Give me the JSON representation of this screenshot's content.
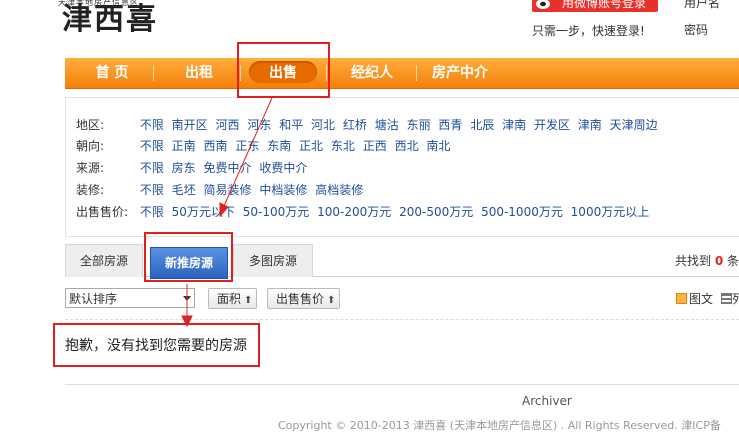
{
  "header": {
    "logo_slogan": "天津本地房产信息区",
    "logo_text": "津西喜",
    "weibo_login": "用微博账号登录",
    "quick_login": "只需一步，快速登录!",
    "username_label": "用户名",
    "password_label": "密码"
  },
  "nav": {
    "items": [
      "首 页",
      "出租",
      "出售",
      "经纪人",
      "房产中介"
    ],
    "active": "出售"
  },
  "filters": [
    {
      "label": "地区:",
      "options": [
        "不限",
        "南开区",
        "河西",
        "河东",
        "和平",
        "河北",
        "红桥",
        "塘沽",
        "东丽",
        "西青",
        "北辰",
        "津南",
        "开发区",
        "津南",
        "天津周边"
      ]
    },
    {
      "label": "朝向:",
      "options": [
        "不限",
        "正南",
        "西南",
        "正东",
        "东南",
        "正北",
        "东北",
        "正西",
        "西北",
        "南北"
      ]
    },
    {
      "label": "来源:",
      "options": [
        "不限",
        "房东",
        "免费中介",
        "收费中介"
      ]
    },
    {
      "label": "装修:",
      "options": [
        "不限",
        "毛坯",
        "简易装修",
        "中档装修",
        "高档装修"
      ]
    },
    {
      "label": "出售售价:",
      "options": [
        "不限",
        "50万元以下",
        "50-100万元",
        "100-200万元",
        "200-500万元",
        "500-1000万元",
        "1000万元以上"
      ]
    }
  ],
  "tabs": [
    "全部房源",
    "新推房源",
    "多图房源"
  ],
  "active_tab": "新推房源",
  "found": {
    "prefix": "共找到",
    "count": "0",
    "suffix": "条"
  },
  "sort": {
    "selected": "默认排序",
    "buttons": [
      "面积",
      "出售售价"
    ],
    "views": [
      "图文",
      "列表"
    ]
  },
  "empty_message": "抱歉，没有找到您需要的房源",
  "footer": {
    "archiver": "Archiver",
    "copyright": "Copyright © 2010-2013 津西喜 (天津本地房产信息区) . All Rights Reserved. 津ICP备"
  },
  "colors": {
    "nav_orange": "#f47f0a",
    "link_blue": "#1f4e9a",
    "tab_blue": "#2a63c0",
    "annotation_red": "#e02020"
  }
}
